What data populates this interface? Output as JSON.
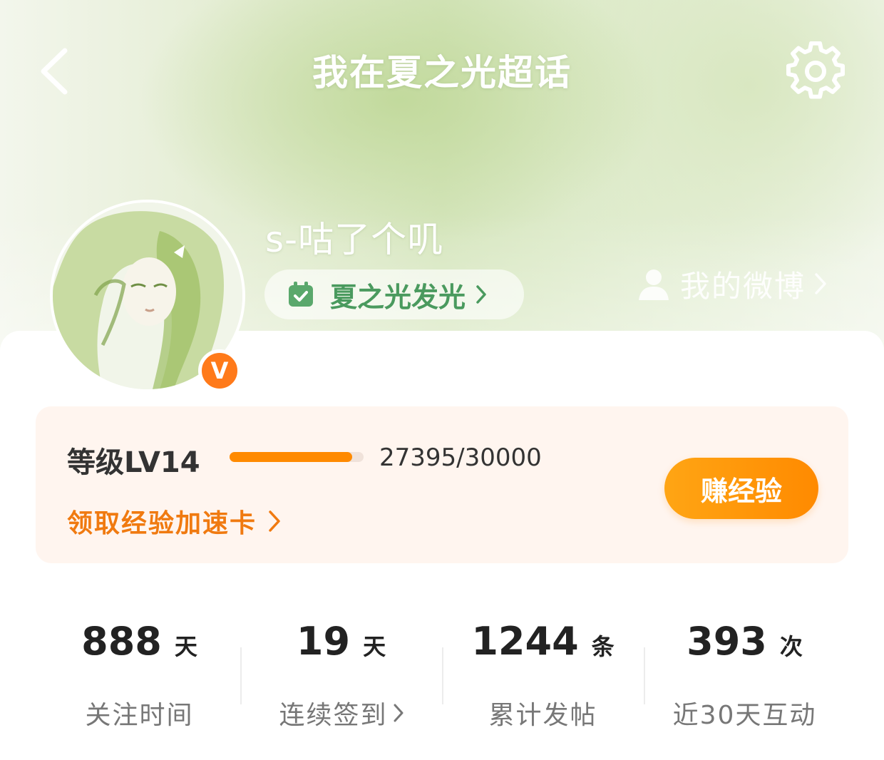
{
  "header": {
    "title": "我在夏之光超话"
  },
  "profile": {
    "username": "s-咕了个叽",
    "verified_badge": "V",
    "tag": "夏之光发光",
    "my_weibo": "我的微博"
  },
  "level": {
    "label": "等级LV14",
    "progress_text": "27395/30000",
    "progress_fraction": 0.913,
    "earn_button": "赚经验",
    "claim_link": "领取经验加速卡"
  },
  "stats": [
    {
      "value": "888",
      "unit": "天",
      "label": "关注时间"
    },
    {
      "value": "19",
      "unit": "天",
      "label": "连续签到"
    },
    {
      "value": "1244",
      "unit": "条",
      "label": "累计发帖"
    },
    {
      "value": "393",
      "unit": "次",
      "label": "近30天互动"
    }
  ],
  "icons": {
    "back": "chevron-left-icon",
    "settings": "gear-icon",
    "calendar_check": "calendar-check-icon",
    "person": "person-icon",
    "chevron_right": "chevron-right-icon"
  },
  "colors": {
    "accent_orange": "#ff8a00",
    "tag_green": "#4a9a5e",
    "badge_orange": "#ff7a1a"
  }
}
